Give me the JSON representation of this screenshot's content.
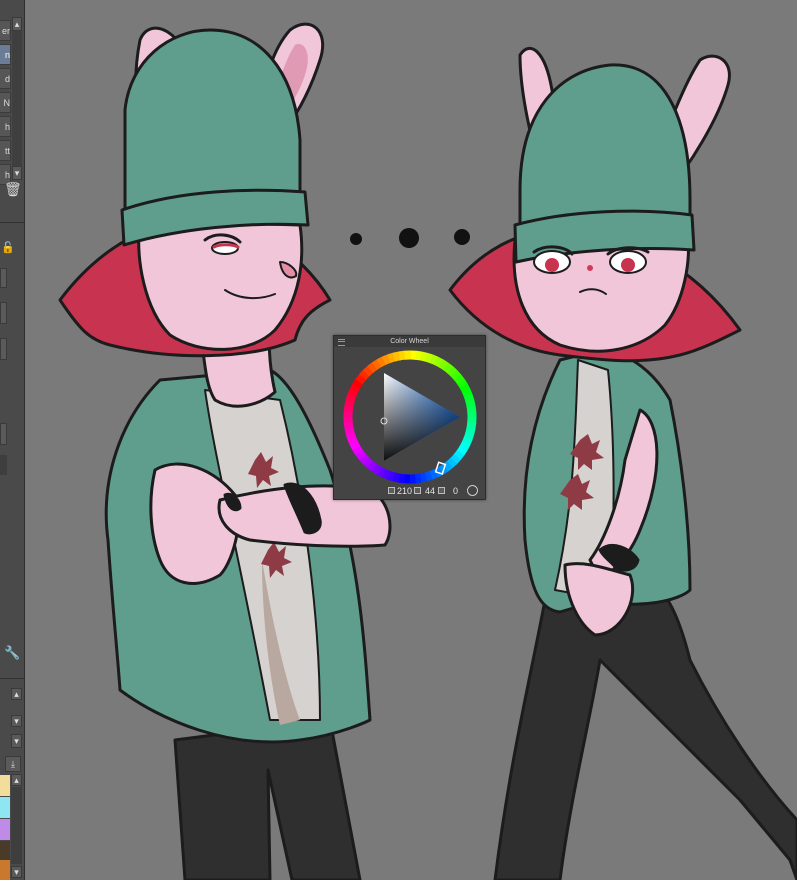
{
  "left_panel": {
    "list_items": [
      "er",
      "n",
      "d",
      "N",
      "h",
      "tt",
      "h"
    ],
    "selected_index": 1,
    "icons": [
      "scroll-up-icon",
      "scroll-down-icon",
      "trash-icon",
      "lock-icon",
      "wrench-icon",
      "download-icon",
      "chevron-down-icon"
    ],
    "swatch_colors": [
      "#f2dd9a",
      "#8fe6f0",
      "#c08ae8",
      "#4a3a2a",
      "#c9782e"
    ]
  },
  "color_wheel": {
    "title": "Color Wheel",
    "hue": "210",
    "saturation": "44",
    "brightness": "0",
    "icons": [
      "hue-icon",
      "saturation-icon",
      "brightness-icon",
      "wheel-mode-icon"
    ]
  },
  "canvas": {
    "background": "#7a7a7a",
    "palette": {
      "hat": "#5f9e8d",
      "fur": "#f0c6d8",
      "hair": "#c8344f",
      "shirt": "#5f9e8d",
      "tee": "#dcdcdc",
      "pants": "#2f2f2f",
      "outline": "#1c1c1c"
    }
  }
}
